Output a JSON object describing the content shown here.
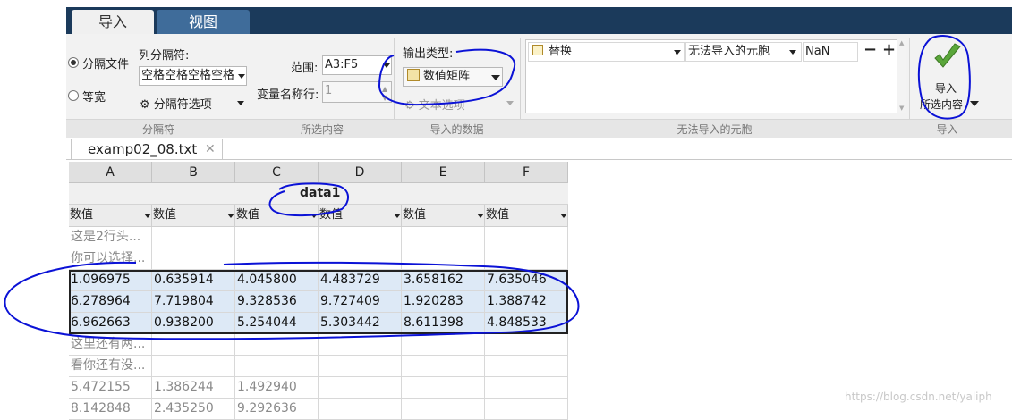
{
  "tabs": {
    "import": "导入",
    "view": "视图"
  },
  "delimiter_group": {
    "radio_delimited": "分隔文件",
    "radio_fixed": "等宽",
    "column_delimiter_label": "列分隔符:",
    "column_delimiter_value": "空格空格空格空格",
    "delimiter_options": "分隔符选项",
    "group_label": "分隔符"
  },
  "selection_group": {
    "range_label": "范围:",
    "range_value": "A3:F5",
    "varname_row_label": "变量名称行:",
    "varname_row_value": "1",
    "group_label": "所选内容"
  },
  "output_group": {
    "output_type_label": "输出类型:",
    "output_type_value": "数值矩阵",
    "text_options": "文本选项",
    "group_label": "导入的数据"
  },
  "unimportable_group": {
    "rule_action": "替换",
    "rule_target": "无法导入的元胞",
    "rule_value": "NaN",
    "group_label": "无法导入的元胞"
  },
  "import_group": {
    "button_label_1": "导入",
    "button_label_2": "所选内容",
    "group_label": "导入"
  },
  "file_tab": {
    "name": "examp02_08.txt"
  },
  "grid": {
    "columns": [
      "A",
      "B",
      "C",
      "D",
      "E",
      "F"
    ],
    "title": "data1",
    "column_type": "数值",
    "rows": [
      [
        "这是2行头...",
        "",
        "",
        "",
        "",
        ""
      ],
      [
        "你可以选择...",
        "",
        "",
        "",
        "",
        ""
      ],
      [
        "1.096975",
        "0.635914",
        "4.045800",
        "4.483729",
        "3.658162",
        "7.635046"
      ],
      [
        "6.278964",
        "7.719804",
        "9.328536",
        "9.727409",
        "1.920283",
        "1.388742"
      ],
      [
        "6.962663",
        "0.938200",
        "5.254044",
        "5.303442",
        "8.611398",
        "4.848533"
      ],
      [
        "这里还有两...",
        "",
        "",
        "",
        "",
        ""
      ],
      [
        "看你还有没...",
        "",
        "",
        "",
        "",
        ""
      ],
      [
        "5.472155",
        "1.386244",
        "1.492940",
        "",
        "",
        ""
      ],
      [
        "8.142848",
        "2.435250",
        "9.292636",
        "",
        "",
        ""
      ]
    ]
  },
  "watermark": "https://blog.csdn.net/yaliph",
  "colors": {
    "accent_dark": "#1b3a5b",
    "tab_inactive": "#3f6c9a",
    "selection": "#dde9f6",
    "annotation": "#0b12d6"
  }
}
